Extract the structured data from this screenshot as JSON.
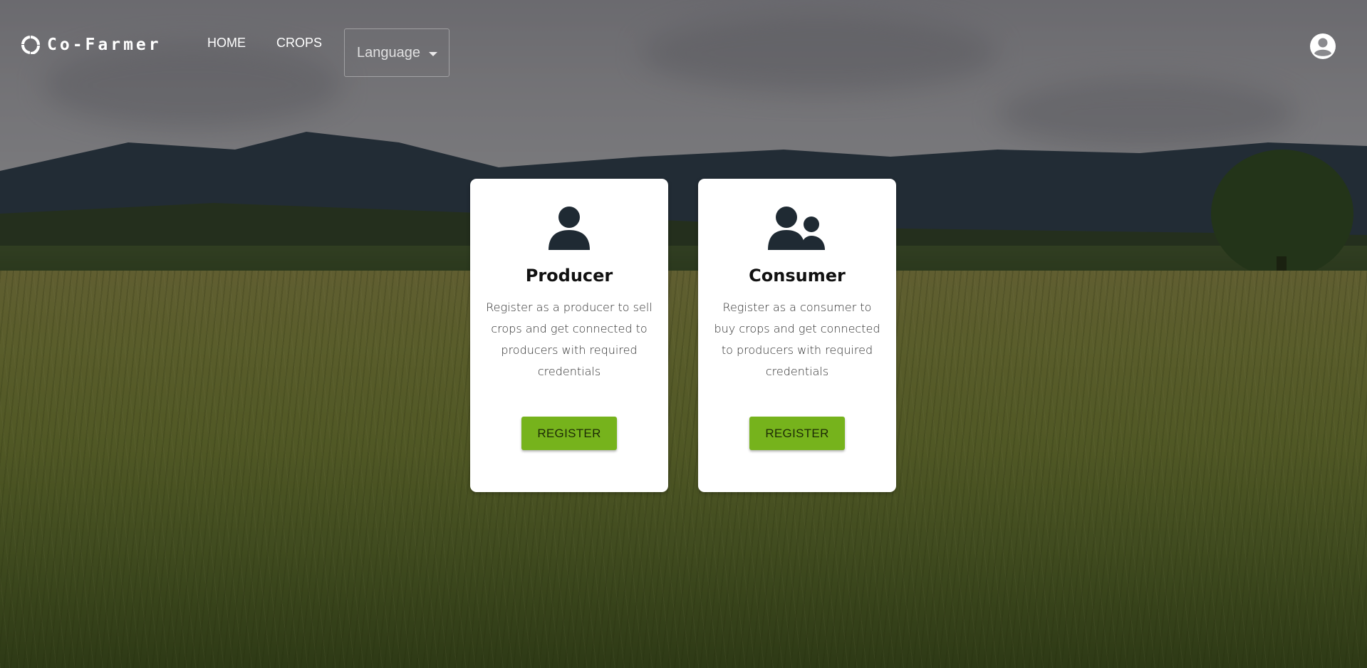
{
  "nav": {
    "brand": "Co-Farmer",
    "links": [
      {
        "label": "HOME"
      },
      {
        "label": "CROPS"
      }
    ],
    "language_select": {
      "value": "Language"
    },
    "account_icon": "account-circle-icon"
  },
  "cards": [
    {
      "icon": "person-icon",
      "title": "Producer",
      "description": "Register as a producer to sell crops and get connected to producers with required credentials",
      "button_label": "REGISTER"
    },
    {
      "icon": "people-icon",
      "title": "Consumer",
      "description": "Register as a consumer to buy crops and get connected to producers with required credentials",
      "button_label": "REGISTER"
    }
  ],
  "colors": {
    "accent": "#76b31c",
    "card_bg": "#ffffff",
    "icon_dark": "#1f2a33"
  }
}
